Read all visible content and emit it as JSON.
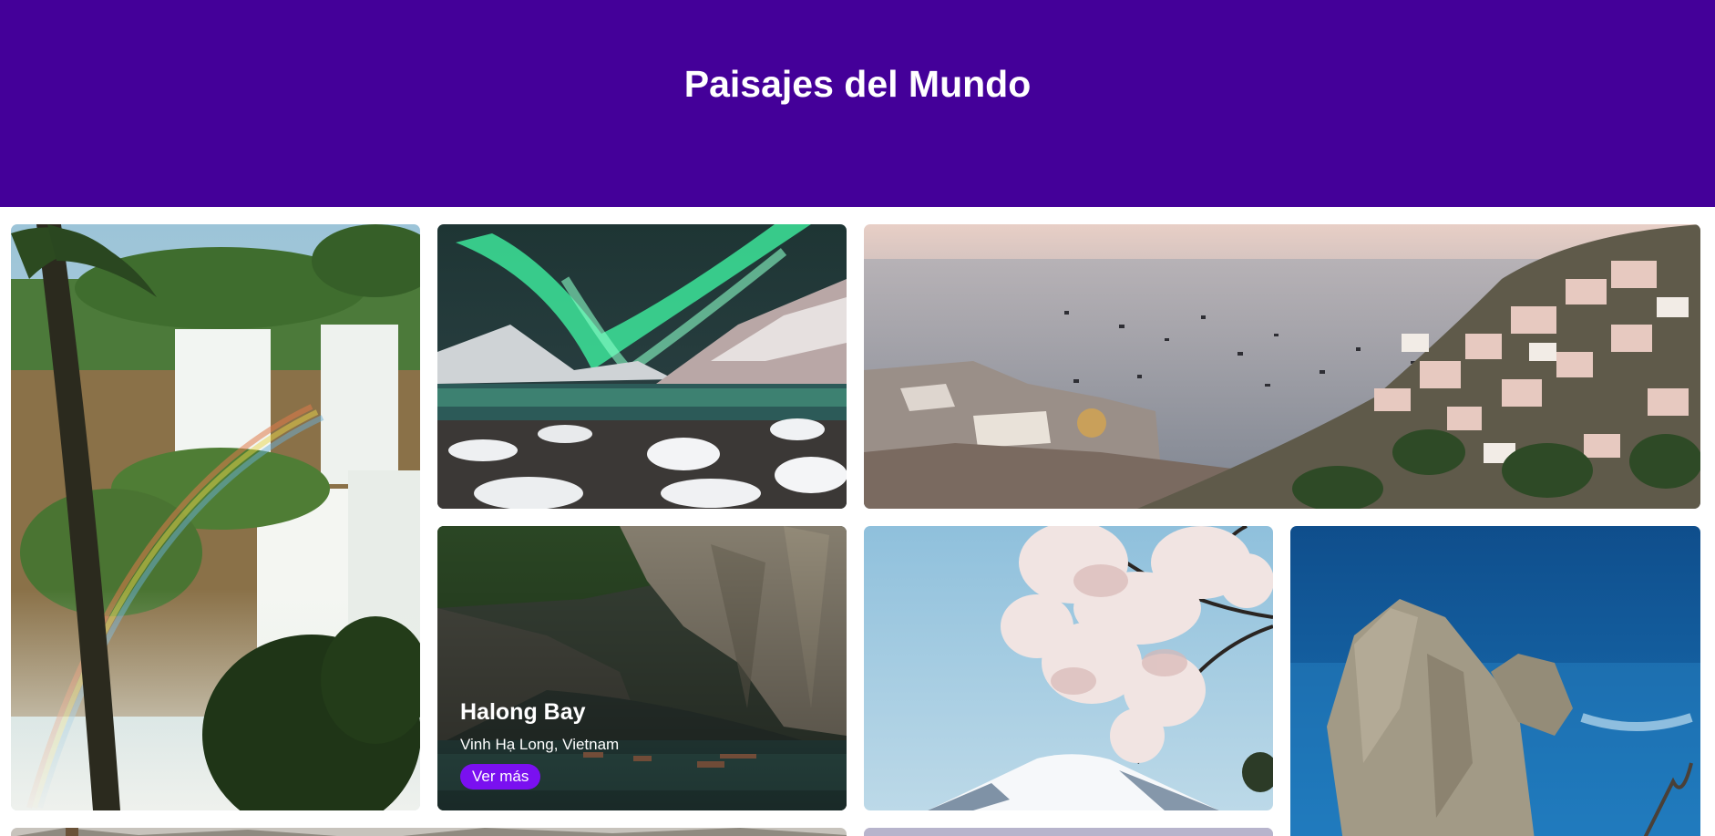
{
  "header": {
    "title": "Paisajes del Mundo"
  },
  "gallery": {
    "featured": {
      "title": "Halong Bay",
      "location": "Vinh Hạ Long, Vietnam",
      "button_label": "Ver más"
    }
  },
  "colors": {
    "header_bg": "#440099",
    "button_bg": "#7a10f0",
    "page_bg": "#ffffff"
  }
}
